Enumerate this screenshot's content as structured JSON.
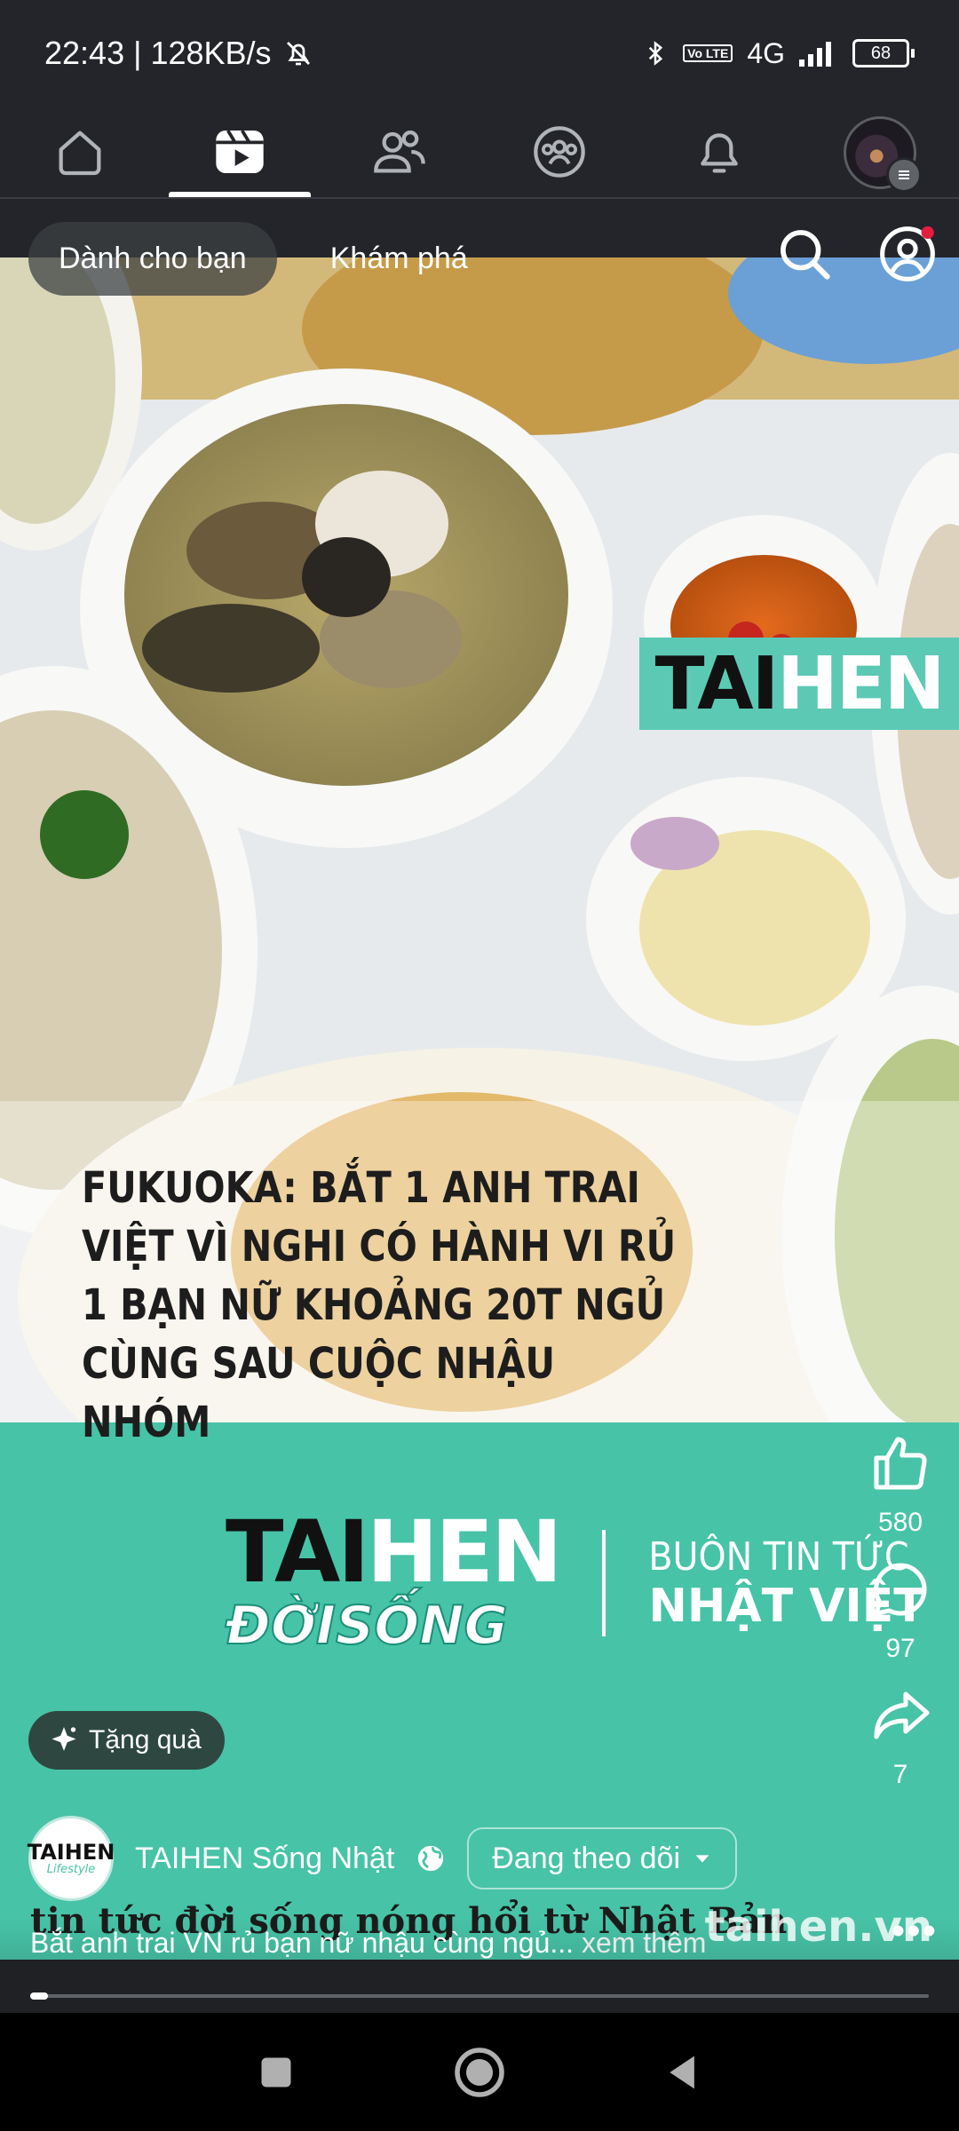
{
  "status": {
    "time_speed": "22:43 | 128KB/s",
    "volte": "Vo LTE",
    "network": "4G",
    "battery": "68"
  },
  "nav": {
    "tabs": [
      {
        "name": "home-icon"
      },
      {
        "name": "video-icon"
      },
      {
        "name": "friends-icon"
      },
      {
        "name": "groups-icon"
      },
      {
        "name": "bell-icon"
      },
      {
        "name": "profile-avatar"
      }
    ],
    "active": 1
  },
  "reels": {
    "tab_for_you": "Dành cho bạn",
    "tab_explore": "Khám phá"
  },
  "video": {
    "logo_part1": "TAI",
    "logo_part2": "HEN",
    "headline": "FUKUOKA: BẮT 1 ANH TRAI VIỆT VÌ NGHI CÓ HÀNH VI RỦ 1 BẠN NỮ KHOẢNG 20T NGỦ CÙNG SAU CUỘC NHẬU NHÓM",
    "brand_part1": "TAI",
    "brand_part2": "HEN",
    "brand_sub": "ĐỜISỐNG",
    "brand_tagline1": "BUÔN TIN TỨC",
    "brand_tagline2": "NHẬT VIỆT",
    "caption_overlay": "tin tức đời sống nóng hổi từ Nhật Bản",
    "watermark": "taihen.vn"
  },
  "actions": {
    "likes": "580",
    "comments": "97",
    "shares": "7"
  },
  "gift_label": "Tặng quà",
  "page": {
    "avatar_line1": "TAIHEN",
    "avatar_line2": "Lifestyle",
    "name": "TAIHEN Sống Nhật",
    "follow_label": "Đang theo dõi"
  },
  "caption": {
    "text": "Bắt anh trai VN rủ bạn nữ nhậu cùng ngủ...",
    "more": "xem thêm"
  },
  "progress": 0.02,
  "colors": {
    "teal": "#47c3a7",
    "bar": "#23252a"
  }
}
